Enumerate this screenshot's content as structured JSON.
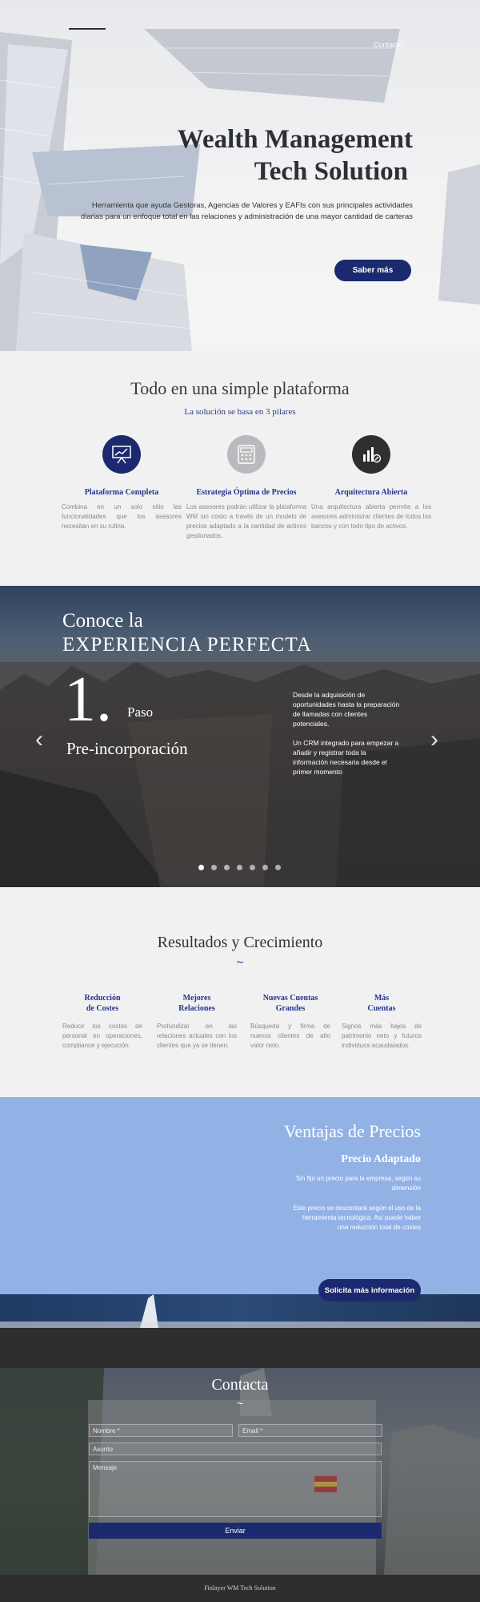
{
  "nav": {
    "contact_label": "Contacto"
  },
  "hero": {
    "title_line1": "Wealth Management",
    "title_line2": "Tech Solution",
    "subtitle": "Herramienta que ayuda Gestoras, Agencias de Valores y EAFIs con sus principales actividades diarias para un enfoque total en las relaciones y administración de una mayor cantidad de carteras",
    "button_label": "Saber más"
  },
  "platform": {
    "title": "Todo en una simple plataforma",
    "subtitle": "La solución se basa en 3 pilares",
    "pillars": [
      {
        "icon": "presentation-chart-icon",
        "color": "#1b2a6e",
        "title": "Plataforma Completa",
        "text": "Combina en un solo sitio las funcionalidades que los asesores necesitan en su rutina."
      },
      {
        "icon": "calculator-icon",
        "color": "#b9babd",
        "title": "Estrategia Óptima de Precios",
        "text": "Los asesores podrán utilizar la plataforma WM sin costo a través de un modelo de precios adaptado a la cantidad de activos gestionados."
      },
      {
        "icon": "chart-growth-icon",
        "color": "#2f2f2f",
        "title": "Arquitectura Abierta",
        "text": "Una arquitectura abierta permite a los asesores administrar clientes de todos los bancos y con todo tipo de activos."
      }
    ]
  },
  "experience": {
    "heading_line1": "Conoce la",
    "heading_line2": "EXPERIENCIA PERFECTA",
    "step_number": "1.",
    "step_word": "Paso",
    "step_title": "Pre-incorporación",
    "text_p1": "Desde la adquisición de oportunidades hasta la preparación de llamadas con clientes potenciales.",
    "text_p2": "Un CRM integrado para empezar a añadir y registrar toda la información necesaria desde el primer momento",
    "slide_count": 7,
    "active_slide": 1
  },
  "results": {
    "title": "Resultados y Crecimiento",
    "tilde": "~",
    "columns": [
      {
        "title_line1": "Reducción",
        "title_line2": "de Costes",
        "text": "Reducir los costes de personal en operaciones, compliance y ejecución."
      },
      {
        "title_line1": "Mejores",
        "title_line2": "Relaciones",
        "text": "Profundizar en las relaciones actuales con los clientes que ya se tienen."
      },
      {
        "title_line1": "Nuevas Cuentas",
        "title_line2": "Grandes",
        "text": "Búsqueda y firma de nuevos clientes de alto valor neto."
      },
      {
        "title_line1": "Más",
        "title_line2": "Cuentas",
        "text": "Signos más bajos de patrimonio neto y futuros individuos acaudalados."
      }
    ]
  },
  "pricing": {
    "title": "Ventajas de Precios",
    "subtitle": "Precio Adaptado",
    "text_p1": "Sin fijo un precio para la empresa, según su dimensión",
    "text_p2": "Este precio se descontará según el uso de la herramienta tecnológica. Así puede haber una reducción total de costes",
    "button_label": "Solicita más información"
  },
  "contact": {
    "title": "Contacta",
    "tilde": "~",
    "name_placeholder": "Nombre *",
    "email_placeholder": "Email *",
    "subject_placeholder": "Asunto",
    "message_placeholder": "Mensaje",
    "send_label": "Enviar"
  },
  "footer": {
    "text": "Finlayer WM Tech Solution"
  }
}
